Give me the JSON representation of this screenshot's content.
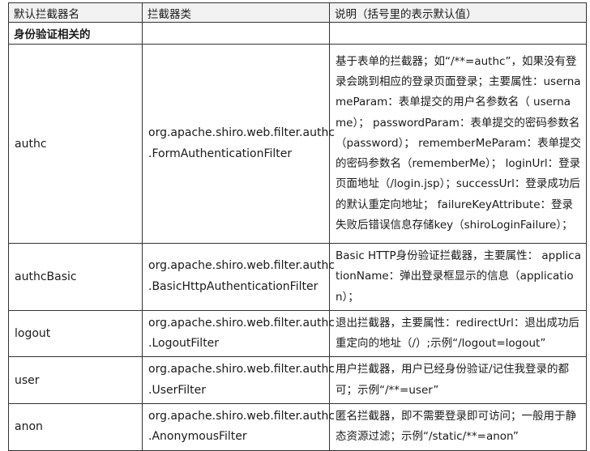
{
  "header": {
    "col1": "默认拦截器名",
    "col2": "拦截器类",
    "col3": "说明（括号里的表示默认值）"
  },
  "section": "身份验证相关的",
  "rows": [
    {
      "name": "authc",
      "class_line1": "org.apache.shiro.web.filter.authc",
      "class_line2": ".FormAuthenticationFilter",
      "desc": "基于表单的拦截器；如“/**=authc”，如果没有登录会跳到相应的登录页面登录；主要属性：usernameParam：表单提交的用户名参数名（ username）； passwordParam：表单提交的密码参数名（password）； rememberMeParam：表单提交的密码参数名（rememberMe）； loginUrl：登录页面地址（/login.jsp）；successUrl：登录成功后的默认重定向地址； failureKeyAttribute：登录失败后错误信息存储key（shiroLoginFailure）；"
    },
    {
      "name": "authcBasic",
      "class_line1": "org.apache.shiro.web.filter.authc",
      "class_line2": ".BasicHttpAuthenticationFilter",
      "desc": "Basic HTTP身份验证拦截器，主要属性： applicationName：弹出登录框显示的信息（application）；"
    },
    {
      "name": "logout",
      "class_line1": "org.apache.shiro.web.filter.authc",
      "class_line2": ".LogoutFilter",
      "desc": "退出拦截器，主要属性：redirectUrl：退出成功后重定向的地址（/）;示例“/logout=logout”"
    },
    {
      "name": "user",
      "class_line1": "org.apache.shiro.web.filter.authc",
      "class_line2": ".UserFilter",
      "desc": "用户拦截器，用户已经身份验证/记住我登录的都可；示例“/**=user”"
    },
    {
      "name": "anon",
      "class_line1": "org.apache.shiro.web.filter.authc",
      "class_line2": ".AnonymousFilter",
      "desc": "匿名拦截器，即不需要登录即可访问；一般用于静态资源过滤；示例“/static/**=anon”"
    }
  ]
}
